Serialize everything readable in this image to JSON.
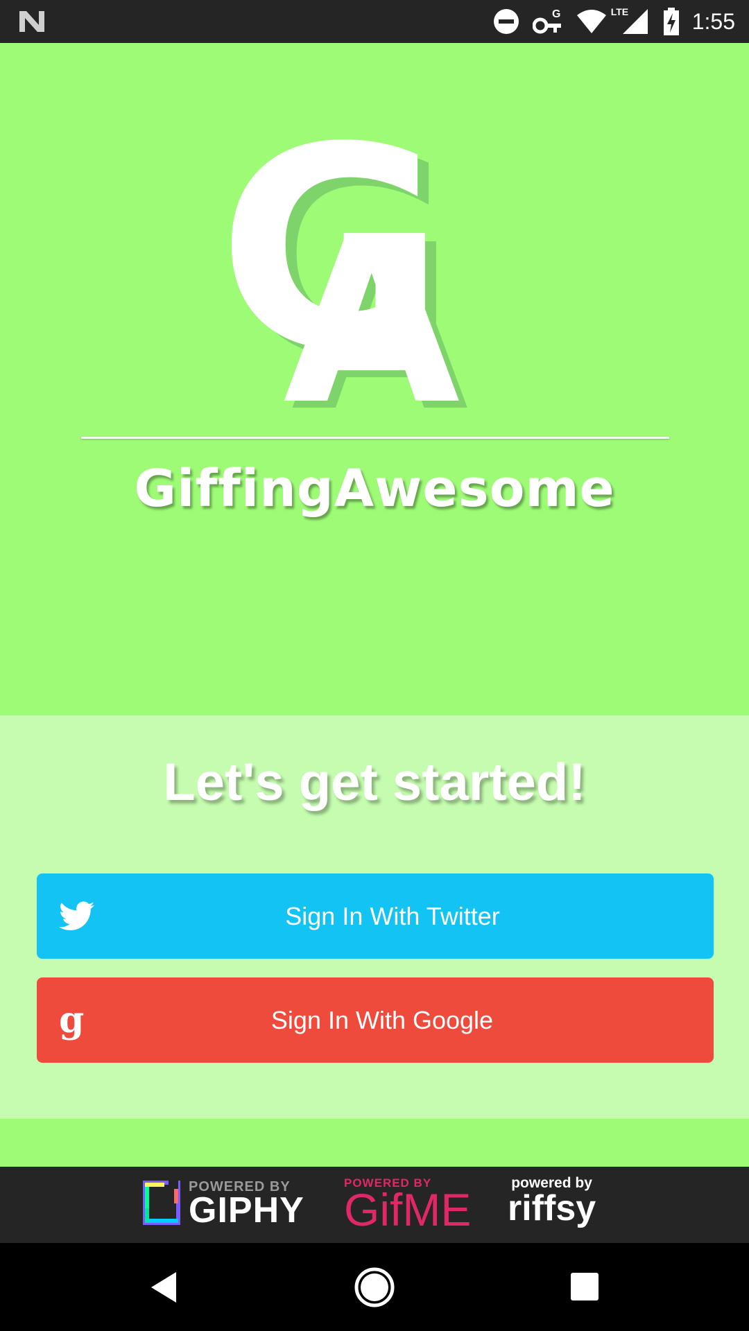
{
  "status_bar": {
    "time": "1:55",
    "network_label": "LTE",
    "icons": [
      "notification-n-icon",
      "do-not-disturb-icon",
      "vpn-key-icon",
      "wifi-icon",
      "cell-signal-icon",
      "battery-charging-icon"
    ]
  },
  "branding": {
    "logo_letters": "GA",
    "app_name": "GiffingAwesome"
  },
  "auth": {
    "tagline": "Let's get started!",
    "twitter_label": "Sign In With Twitter",
    "google_label": "Sign In With Google",
    "google_icon_glyph": "g"
  },
  "providers": {
    "giphy_small": "POWERED BY",
    "giphy_large": "GIPHY",
    "gifme_small": "POWERED BY",
    "gifme_large": "GifME",
    "riffsy_small": "powered by",
    "riffsy_large": "riffsy"
  },
  "colors": {
    "hero_bg": "#9dfb76",
    "panel_bg": "#c5fcaf",
    "twitter": "#13c3f3",
    "google": "#ef4b3c",
    "gifme": "#e02868"
  }
}
